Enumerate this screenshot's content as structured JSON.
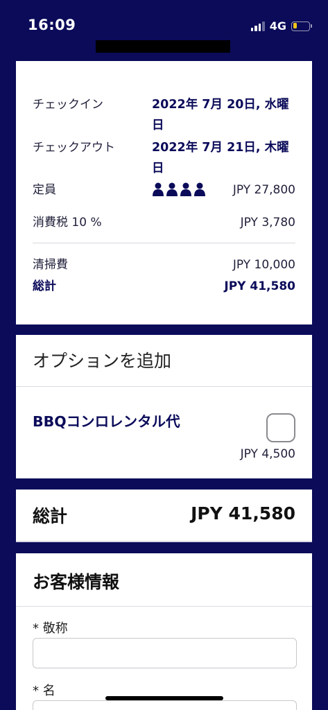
{
  "status_bar": {
    "time": "16:09",
    "network": "4G",
    "battery_level": 0.25
  },
  "summary": {
    "check_in_label": "チェックイン",
    "check_in_date": "2022年 7月 20日, 水曜日",
    "check_out_label": "チェックアウト",
    "check_out_date": "2022年 7月 21日, 木曜日",
    "capacity_label": "定員",
    "capacity_people_icons": 4,
    "capacity_amount": "JPY 27,800",
    "tax_label": "消費税 10 %",
    "tax_amount": "JPY 3,780",
    "cleaning_label": "清掃費",
    "cleaning_amount": "JPY 10,000",
    "subtotal_label": "総計",
    "subtotal_amount": "JPY 41,580"
  },
  "options": {
    "header": "オプションを追加",
    "item_name": "BBQコンロレンタル代",
    "item_price": "JPY 4,500",
    "item_checked": false
  },
  "total": {
    "label": "総計",
    "amount": "JPY 41,580"
  },
  "guest": {
    "title": "お客様情報",
    "honorific_label": "* 敬称",
    "honorific_value": "",
    "name_label": "* 名",
    "name_value": ""
  },
  "colors": {
    "background": "#0b0b5a",
    "accent_text": "#0b0b5a",
    "battery": "#f5c518"
  }
}
